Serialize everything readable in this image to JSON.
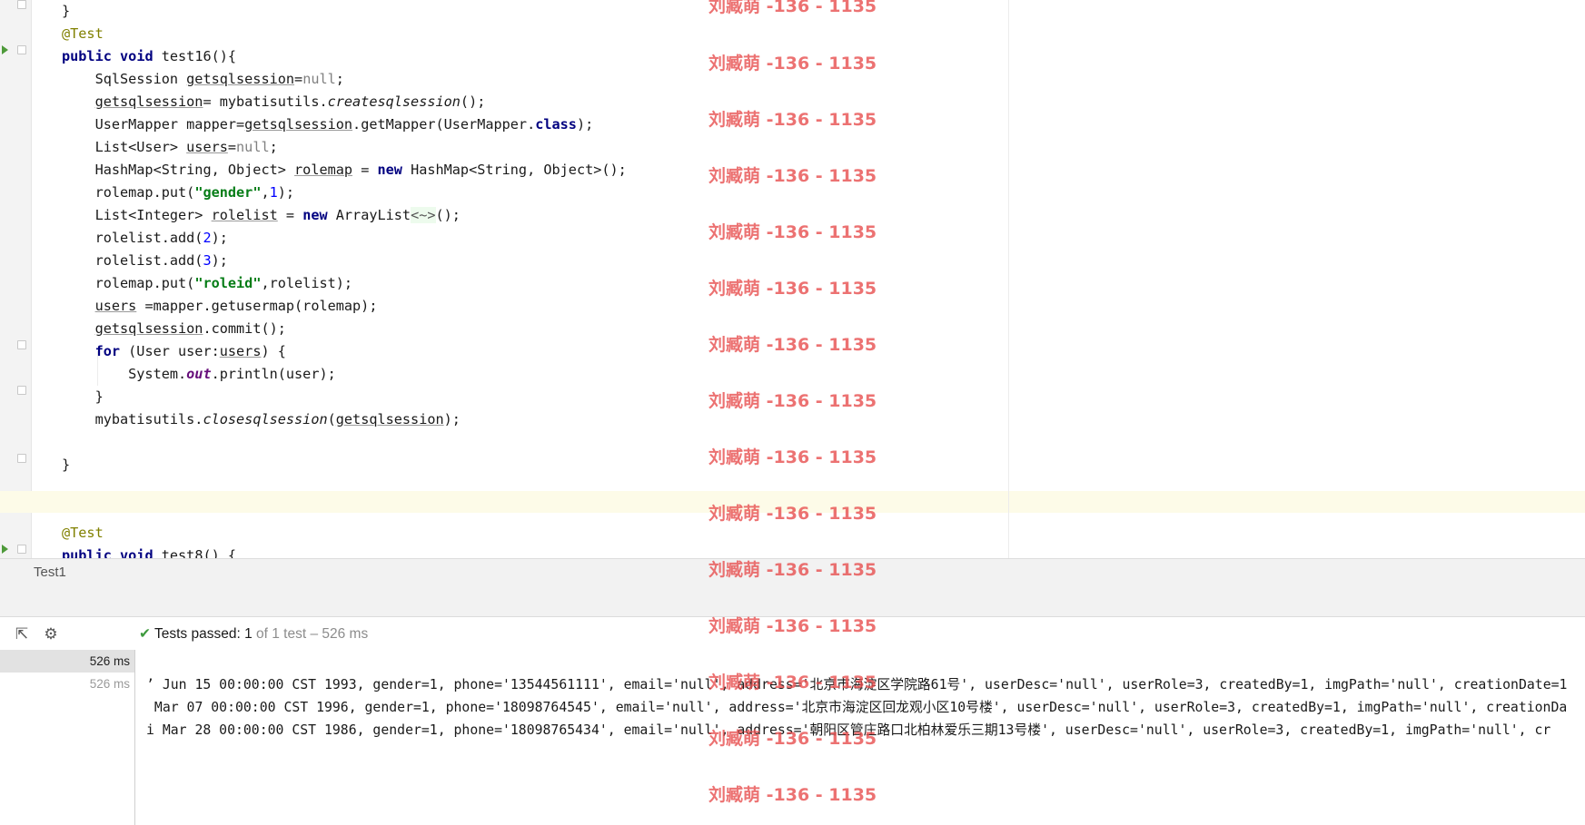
{
  "editor": {
    "lines": [
      [
        {
          "t": "}"
        }
      ],
      [
        {
          "t": "@Test",
          "c": "anno"
        }
      ],
      [
        {
          "t": "public",
          "c": "kw"
        },
        {
          "t": " "
        },
        {
          "t": "void",
          "c": "kw"
        },
        {
          "t": " test16(){"
        }
      ],
      [
        {
          "t": "    SqlSession "
        },
        {
          "t": "getsqlsession",
          "c": "ul"
        },
        {
          "t": "="
        },
        {
          "t": "null",
          "c": "nul"
        },
        {
          "t": ";"
        }
      ],
      [
        {
          "t": "    "
        },
        {
          "t": "getsqlsession",
          "c": "ul"
        },
        {
          "t": "= mybatisutils."
        },
        {
          "t": "createsqlsession",
          "c": "it"
        },
        {
          "t": "();"
        }
      ],
      [
        {
          "t": "    UserMapper mapper="
        },
        {
          "t": "getsqlsession",
          "c": "ul"
        },
        {
          "t": ".getMapper(UserMapper."
        },
        {
          "t": "class",
          "c": "kw"
        },
        {
          "t": ");"
        }
      ],
      [
        {
          "t": "    List<User> "
        },
        {
          "t": "users",
          "c": "ul"
        },
        {
          "t": "="
        },
        {
          "t": "null",
          "c": "nul"
        },
        {
          "t": ";"
        }
      ],
      [
        {
          "t": "    HashMap<String, Object> "
        },
        {
          "t": "rolemap",
          "c": "ul"
        },
        {
          "t": " = "
        },
        {
          "t": "new",
          "c": "kw"
        },
        {
          "t": " HashMap<String, Object>();"
        }
      ],
      [
        {
          "t": "    rolemap.put("
        },
        {
          "t": "\"gender\"",
          "c": "str"
        },
        {
          "t": ","
        },
        {
          "t": "1",
          "c": "num"
        },
        {
          "t": ");"
        }
      ],
      [
        {
          "t": "    List<Integer> "
        },
        {
          "t": "rolelist",
          "c": "ul"
        },
        {
          "t": " = "
        },
        {
          "t": "new",
          "c": "kw"
        },
        {
          "t": " ArrayList"
        },
        {
          "t": "<~>",
          "c": "hint"
        },
        {
          "t": "();"
        }
      ],
      [
        {
          "t": "    rolelist.add("
        },
        {
          "t": "2",
          "c": "num"
        },
        {
          "t": ");"
        }
      ],
      [
        {
          "t": "    rolelist.add("
        },
        {
          "t": "3",
          "c": "num"
        },
        {
          "t": ");"
        }
      ],
      [
        {
          "t": "    rolemap.put("
        },
        {
          "t": "\"roleid\"",
          "c": "str"
        },
        {
          "t": ",rolelist);"
        }
      ],
      [
        {
          "t": "    "
        },
        {
          "t": "users",
          "c": "ul"
        },
        {
          "t": " =mapper.getusermap(rolemap);"
        }
      ],
      [
        {
          "t": "    "
        },
        {
          "t": "getsqlsession",
          "c": "ul"
        },
        {
          "t": ".commit();"
        }
      ],
      [
        {
          "t": "    "
        },
        {
          "t": "for",
          "c": "kw"
        },
        {
          "t": " (User user:"
        },
        {
          "t": "users",
          "c": "ul"
        },
        {
          "t": ") {"
        }
      ],
      [
        {
          "t": "        System."
        },
        {
          "t": "out",
          "c": "field"
        },
        {
          "t": ".println(user);"
        }
      ],
      [
        {
          "t": "    }"
        }
      ],
      [
        {
          "t": "    mybatisutils."
        },
        {
          "t": "closesqlsession",
          "c": "it"
        },
        {
          "t": "("
        },
        {
          "t": "getsqlsession",
          "c": "ul"
        },
        {
          "t": ");"
        }
      ],
      [
        {
          "t": ""
        }
      ],
      [
        {
          "t": "}"
        }
      ],
      [
        {
          "t": ""
        }
      ],
      [
        {
          "t": ""
        }
      ],
      [
        {
          "t": "@Test",
          "c": "anno"
        }
      ],
      [
        {
          "t": "public",
          "c": "kw"
        },
        {
          "t": " "
        },
        {
          "t": "void",
          "c": "kw"
        },
        {
          "t": " test8() {"
        }
      ]
    ]
  },
  "tab_bar": {
    "label": "Test1"
  },
  "toolbar": {
    "export_icon": "export-icon",
    "settings_icon": "gear-icon",
    "check_icon": "check-icon",
    "status_prefix": "Tests passed: ",
    "status_passed": "1",
    "status_rest": " of 1 test – 526 ms"
  },
  "results": {
    "times": [
      "526 ms",
      "526 ms"
    ]
  },
  "console": {
    "lines": [
      "’ Jun 15 00:00:00 CST 1993, gender=1, phone='13544561111', email='null', address='北京市海淀区学院路61号', userDesc='null', userRole=3, createdBy=1, imgPath='null', creationDate=1",
      " Mar 07 00:00:00 CST 1996, gender=1, phone='18098764545', email='null', address='北京市海淀区回龙观小区10号楼', userDesc='null', userRole=3, createdBy=1, imgPath='null', creationDa",
      "i Mar 28 00:00:00 CST 1986, gender=1, phone='18098765434', email='null', address='朝阳区管庄路口北柏林爱乐三期13号楼', userDesc='null', userRole=3, createdBy=1, imgPath='null', cr"
    ]
  },
  "watermark": {
    "text": "刘臧萌 -136 - 1135",
    "color": "#e85050"
  }
}
